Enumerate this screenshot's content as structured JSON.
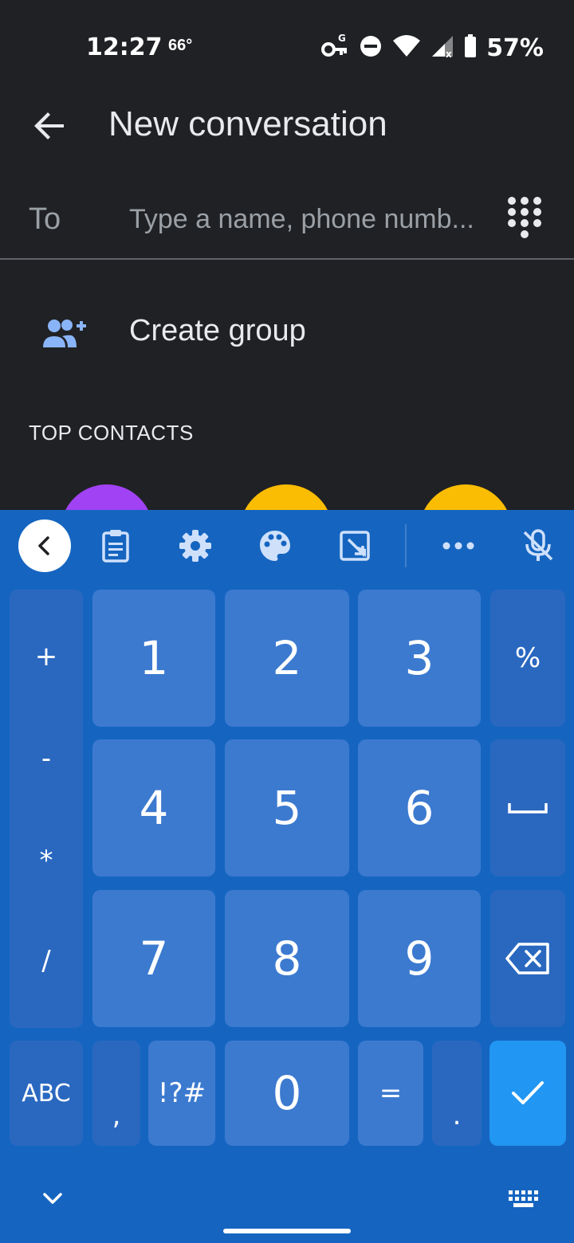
{
  "status_bar": {
    "time": "12:27",
    "temperature": "66°",
    "battery": "57%"
  },
  "app_bar": {
    "title": "New conversation"
  },
  "recipient": {
    "label": "To",
    "placeholder": "Type a name, phone numb..."
  },
  "create_group": {
    "label": "Create group"
  },
  "top_contacts": {
    "header": "TOP CONTACTS",
    "avatar_colors": [
      "#a142f4",
      "#fbbc04",
      "#fbbc04"
    ]
  },
  "keyboard": {
    "symbols": [
      "+",
      "-",
      "*",
      "/"
    ],
    "digits": [
      "1",
      "2",
      "3",
      "4",
      "5",
      "6",
      "7",
      "8",
      "9",
      "0"
    ],
    "percent": "%",
    "abc": "ABC",
    "comma": ",",
    "symbols_key": "!?#",
    "equals": "=",
    "period": ".",
    "colors": {
      "background": "#1565c0",
      "key": "#3c7ad0",
      "enter": "#2196f3"
    }
  }
}
